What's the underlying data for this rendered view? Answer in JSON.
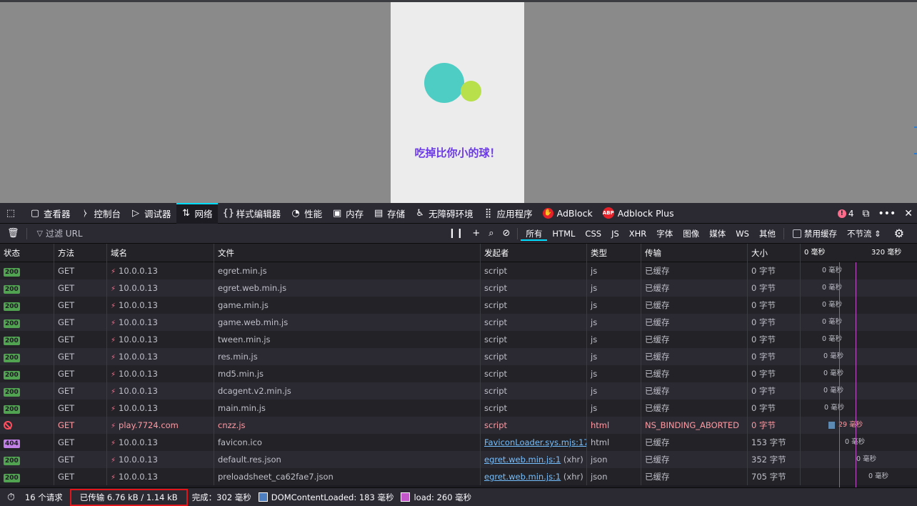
{
  "game": {
    "text": "吃掉比你小的球！"
  },
  "tabs": [
    {
      "label": "查看器",
      "icon": "inspector-icon",
      "glyph": "▢"
    },
    {
      "label": "控制台",
      "icon": "console-icon",
      "glyph": "⧽"
    },
    {
      "label": "调试器",
      "icon": "debugger-icon",
      "glyph": "▷"
    },
    {
      "label": "网络",
      "icon": "network-icon",
      "glyph": "⇅"
    },
    {
      "label": "样式编辑器",
      "icon": "style-editor-icon",
      "glyph": "{}"
    },
    {
      "label": "性能",
      "icon": "performance-icon",
      "glyph": "◔"
    },
    {
      "label": "内存",
      "icon": "memory-icon",
      "glyph": "▣"
    },
    {
      "label": "存储",
      "icon": "storage-icon",
      "glyph": "▤"
    },
    {
      "label": "无障碍环境",
      "icon": "accessibility-icon",
      "glyph": "♿"
    },
    {
      "label": "应用程序",
      "icon": "application-icon",
      "glyph": "⣿"
    },
    {
      "label": "AdBlock",
      "icon": "adblock-icon",
      "glyph": "✋"
    },
    {
      "label": "Adblock Plus",
      "icon": "adblock-plus-icon",
      "glyph": "ABP"
    }
  ],
  "error_count": "4",
  "filter": {
    "placeholder": "过滤 URL",
    "types": [
      "所有",
      "HTML",
      "CSS",
      "JS",
      "XHR",
      "字体",
      "图像",
      "媒体",
      "WS",
      "其他"
    ],
    "disable_cache": "禁用缓存",
    "throttle": "不节流 ⇕"
  },
  "columns": [
    "状态",
    "方法",
    "域名",
    "文件",
    "发起者",
    "类型",
    "传输",
    "大小",
    "0 毫秒",
    "320 毫秒"
  ],
  "requests": [
    {
      "status": "200",
      "method": "GET",
      "domain": "10.0.0.13",
      "file": "egret.min.js",
      "initiator": "script",
      "initiator_suffix": "",
      "type": "js",
      "transfer": "已缓存",
      "size": "0 字节",
      "timing": "0 毫秒"
    },
    {
      "status": "200",
      "method": "GET",
      "domain": "10.0.0.13",
      "file": "egret.web.min.js",
      "initiator": "script",
      "initiator_suffix": "",
      "type": "js",
      "transfer": "已缓存",
      "size": "0 字节",
      "timing": "0 毫秒"
    },
    {
      "status": "200",
      "method": "GET",
      "domain": "10.0.0.13",
      "file": "game.min.js",
      "initiator": "script",
      "initiator_suffix": "",
      "type": "js",
      "transfer": "已缓存",
      "size": "0 字节",
      "timing": "0 毫秒"
    },
    {
      "status": "200",
      "method": "GET",
      "domain": "10.0.0.13",
      "file": "game.web.min.js",
      "initiator": "script",
      "initiator_suffix": "",
      "type": "js",
      "transfer": "已缓存",
      "size": "0 字节",
      "timing": "0 毫秒"
    },
    {
      "status": "200",
      "method": "GET",
      "domain": "10.0.0.13",
      "file": "tween.min.js",
      "initiator": "script",
      "initiator_suffix": "",
      "type": "js",
      "transfer": "已缓存",
      "size": "0 字节",
      "timing": "0 毫秒"
    },
    {
      "status": "200",
      "method": "GET",
      "domain": "10.0.0.13",
      "file": "res.min.js",
      "initiator": "script",
      "initiator_suffix": "",
      "type": "js",
      "transfer": "已缓存",
      "size": "0 字节",
      "timing": "0 毫秒"
    },
    {
      "status": "200",
      "method": "GET",
      "domain": "10.0.0.13",
      "file": "md5.min.js",
      "initiator": "script",
      "initiator_suffix": "",
      "type": "js",
      "transfer": "已缓存",
      "size": "0 字节",
      "timing": "0 毫秒"
    },
    {
      "status": "200",
      "method": "GET",
      "domain": "10.0.0.13",
      "file": "dcagent.v2.min.js",
      "initiator": "script",
      "initiator_suffix": "",
      "type": "js",
      "transfer": "已缓存",
      "size": "0 字节",
      "timing": "0 毫秒"
    },
    {
      "status": "200",
      "method": "GET",
      "domain": "10.0.0.13",
      "file": "main.min.js",
      "initiator": "script",
      "initiator_suffix": "",
      "type": "js",
      "transfer": "已缓存",
      "size": "0 字节",
      "timing": "0 毫秒"
    },
    {
      "status": "blocked",
      "method": "GET",
      "domain": "play.7724.com",
      "file": "cnzz.js",
      "initiator": "script",
      "initiator_suffix": "",
      "type": "html",
      "transfer": "NS_BINDING_ABORTED",
      "size": "0 字节",
      "timing": "29 毫秒"
    },
    {
      "status": "404",
      "method": "GET",
      "domain": "10.0.0.13",
      "file": "favicon.ico",
      "initiator": "FaviconLoader.sys.mjs:17...",
      "initiator_suffix": "",
      "type": "html",
      "transfer": "已缓存",
      "size": "153 字节",
      "timing": "0 毫秒"
    },
    {
      "status": "200",
      "method": "GET",
      "domain": "10.0.0.13",
      "file": "default.res.json",
      "initiator": "egret.web.min.js:1",
      "initiator_suffix": " (xhr)",
      "type": "json",
      "transfer": "已缓存",
      "size": "352 字节",
      "timing": "0 毫秒"
    },
    {
      "status": "200",
      "method": "GET",
      "domain": "10.0.0.13",
      "file": "preloadsheet_ca62fae7.json",
      "initiator": "egret.web.min.js:1",
      "initiator_suffix": " (xhr)",
      "type": "json",
      "transfer": "已缓存",
      "size": "705 字节",
      "timing": "0 毫秒"
    }
  ],
  "footer": {
    "request_count": "16 个请求",
    "transferred": "已传输 6.76 kB / 1.14 kB",
    "finish": "完成：302 毫秒",
    "dcl": "DOMContentLoaded: 183 毫秒",
    "load": "load: 260 毫秒"
  },
  "colors": {
    "dcl_line": "#4d7fc0",
    "load_line": "#c257c9",
    "status_ok": "#51a351",
    "status_404": "#c080e6",
    "error_text": "#ff9aa2",
    "highlight_box": "#e0141b"
  }
}
